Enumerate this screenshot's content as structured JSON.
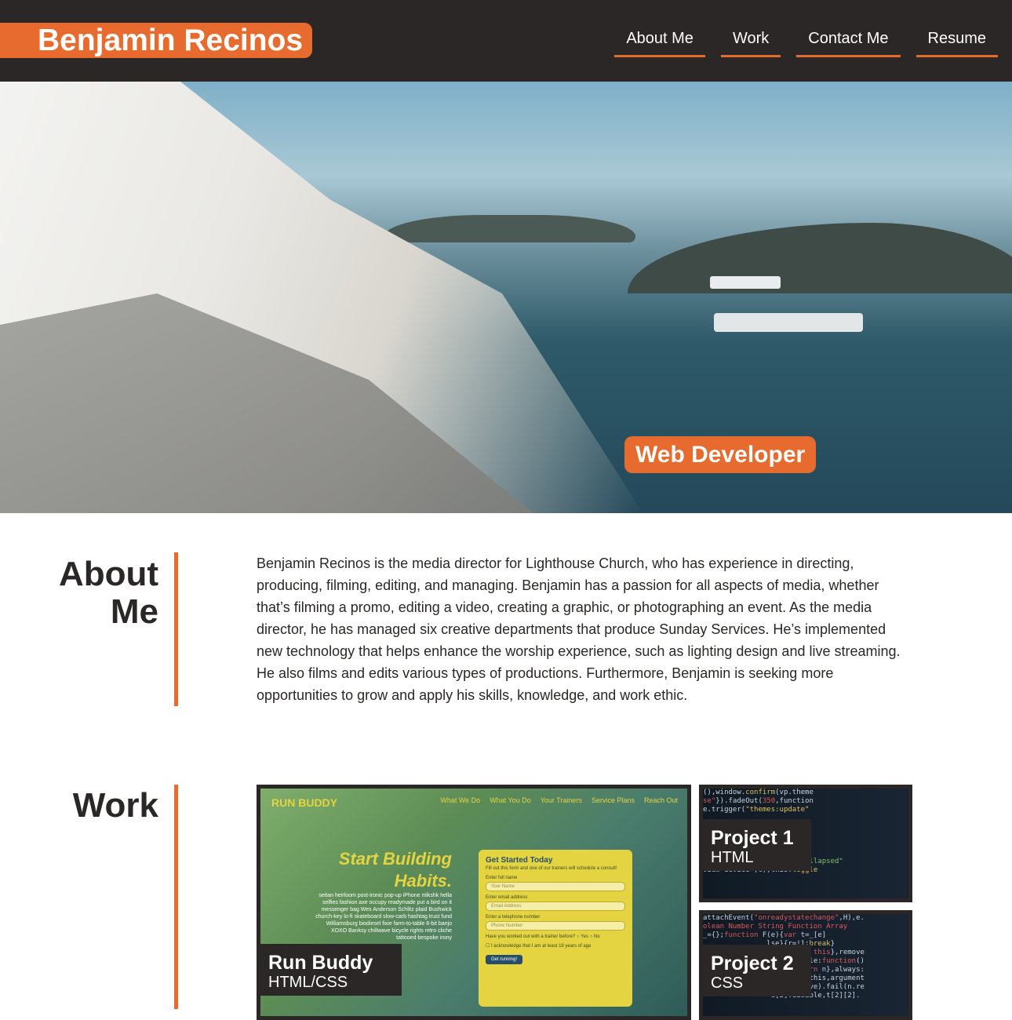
{
  "header": {
    "brand": "Benjamin Recinos",
    "nav": [
      "About Me",
      "Work",
      "Contact Me",
      "Resume"
    ]
  },
  "hero": {
    "badge": "Web Developer"
  },
  "about": {
    "title_line1": "About",
    "title_line2": "Me",
    "text": "Benjamin Recinos is the media director for Lighthouse Church, who has experience in directing, producing, filming, editing, and managing. Benjamin has a passion for all aspects of media, whether that’s filming a promo, editing a video, creating a graphic, or photographing an event. As the media director, he has managed six creative departments that produce Sunday Services. He’s implemented new technology that helps enhance the worship experience, such as lighting design and live streaming. He also films and edits various types of productions. Furthermore, Benjamin is seeking more opportunities to grow and apply his skills, knowledge, and work ethic."
  },
  "work": {
    "title": "Work",
    "featured": {
      "name": "Run Buddy",
      "tech": "HTML/CSS",
      "screenshot": {
        "logo": "RUN BUDDY",
        "nav": [
          "What We Do",
          "What You Do",
          "Your Trainers",
          "Service Plans",
          "Reach Out"
        ],
        "headline_1": "Start Building",
        "headline_2": "Habits.",
        "body": "seitan heirloom post-ironic pop-up iPhone mlkshk hella selfies fashion axe occupy readymade put a bird on it messenger bag Wes Anderson Schlitz plaid Bushwick church-key lo-fi skateboard slow-carb hashtag trust fund Williamsburg biodiesel fixie farm-to-table 8-bit banjo XOXO Banksy chillwave bicycle rights retro cliche tattooed bespoke irony",
        "form_title": "Get Started Today",
        "form_sub": "Fill out this form and one of our trainers will schedule a consult!",
        "label_name": "Enter full name",
        "ph_name": "Your Name",
        "label_email": "Enter email address",
        "ph_email": "Email Address",
        "label_phone": "Enter a telephone number",
        "ph_phone": "Phone Number",
        "question": "Have you worked out with a trainer before?",
        "yes": "Yes",
        "no": "No",
        "ack": "I acknowledge that I am at least 18 years of age",
        "button": "Get running!"
      }
    },
    "projects": [
      {
        "name": "Project 1",
        "tech": "HTML"
      },
      {
        "name": "Project 2",
        "tech": "CSS"
      }
    ]
  }
}
